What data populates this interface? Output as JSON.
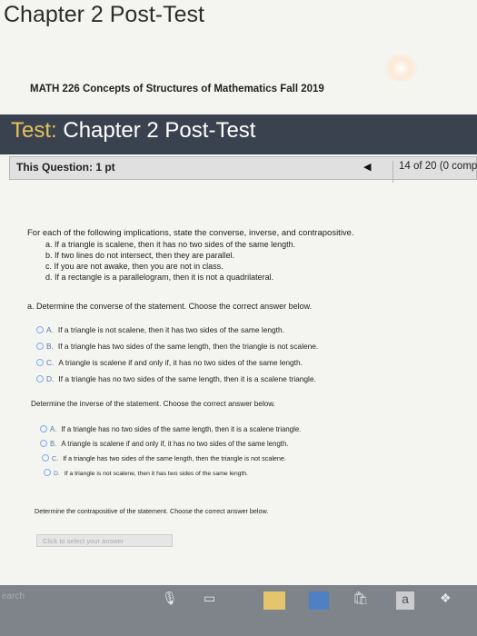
{
  "page": {
    "title": "Chapter 2 Post-Test",
    "course": "MATH 226 Concepts of Structures of Mathematics Fall 2019"
  },
  "test": {
    "label": "Test:",
    "name": "Chapter 2 Post-Test"
  },
  "question_bar": {
    "info": "This Question: 1 pt",
    "progress": "14 of 20 (0 comp"
  },
  "question": {
    "prompt": "For each of the following implications, state the converse, inverse, and contrapositive.",
    "implications": [
      "a. If a triangle is scalene, then it has no two sides of the same length.",
      "b. If two lines do not intersect, then they are parallel.",
      "c. If you are not awake, then you are not in class.",
      "d. If a rectangle is a parallelogram, then it is not a quadrilateral."
    ],
    "part_a": "a. Determine the converse of the statement. Choose the correct answer below.",
    "part_a_options": [
      {
        "letter": "A.",
        "text": "If a triangle is not scalene, then it has two sides of the same length."
      },
      {
        "letter": "B.",
        "text": "If a triangle has two sides of the same length, then the triangle is not scalene."
      },
      {
        "letter": "C.",
        "text": "A triangle is scalene if and only if, it has no two sides of the same length."
      },
      {
        "letter": "D.",
        "text": "If a triangle has no two sides of the same length, then it is a scalene triangle."
      }
    ],
    "inverse_prompt": "Determine the inverse of the statement. Choose the correct answer below.",
    "inverse_options": [
      {
        "letter": "A.",
        "text": "If a triangle has no two sides of the same length, then it is a scalene triangle."
      },
      {
        "letter": "B.",
        "text": "A triangle is scalene if and only if, it has no two sides of the same length."
      },
      {
        "letter": "C.",
        "text": "If a triangle has two sides of the same length, then the triangle is not scalene."
      },
      {
        "letter": "D.",
        "text": "If a triangle is not scalene, then it has two sides of the same length."
      }
    ],
    "contrapositive_prompt": "Determine the contrapositive of the statement. Choose the correct answer below.",
    "answer_placeholder": "Click to select your answer"
  },
  "taskbar": {
    "search_text": "earch",
    "icons": [
      "microphone-icon",
      "task-view-icon",
      "file-explorer-icon",
      "store-icon",
      "office-icon",
      "dropbox-icon"
    ]
  }
}
